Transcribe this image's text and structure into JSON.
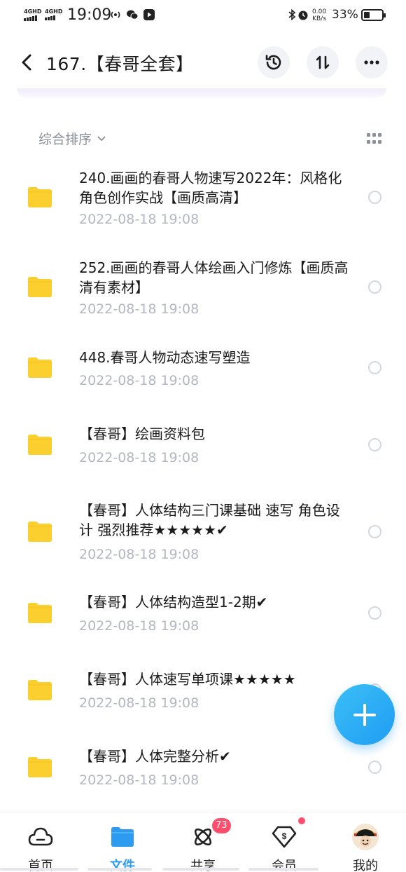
{
  "status_bar": {
    "sim1": "4GHD",
    "sim2": "4GHD",
    "time": "19:09",
    "speed_value": "0.00",
    "speed_unit": "KB/s",
    "battery": "33%",
    "battery_level": 0.33
  },
  "header": {
    "title": "167.【春哥全套】"
  },
  "toolbar": {
    "sort_label": "综合排序"
  },
  "files": [
    {
      "name": "240.画画的春哥人物速写2022年：风格化角色创作实战【画质高清】",
      "date": "2022-08-18  19:08"
    },
    {
      "name": "252.画画的春哥人体绘画入门修炼【画质高清有素材】",
      "date": "2022-08-18  19:08"
    },
    {
      "name": "448.春哥人物动态速写塑造",
      "date": "2022-08-18  19:08"
    },
    {
      "name": "【春哥】绘画资料包",
      "date": "2022-08-18  19:08"
    },
    {
      "name": "【春哥】人体结构三门课基础 速写 角色设计  强烈推荐★★★★★✔",
      "date": "2022-08-18  19:08"
    },
    {
      "name": "【春哥】人体结构造型1-2期✔",
      "date": "2022-08-18  19:08"
    },
    {
      "name": "【春哥】人体速写单项课★★★★★",
      "date": "2022-08-18  19:08"
    },
    {
      "name": "【春哥】人体完整分析✔",
      "date": "2022-08-18  19:08"
    }
  ],
  "nav": {
    "items": [
      {
        "label": "首页",
        "icon": "cloud-icon"
      },
      {
        "label": "文件",
        "icon": "folder-icon"
      },
      {
        "label": "共享",
        "icon": "share-icon"
      },
      {
        "label": "会员",
        "icon": "vip-icon"
      },
      {
        "label": "我的",
        "icon": "avatar"
      }
    ],
    "share_badge": "73"
  },
  "colors": {
    "accent": "#2d9cf0",
    "folder": "#fbcf2e",
    "badge": "#ff4d6b"
  }
}
